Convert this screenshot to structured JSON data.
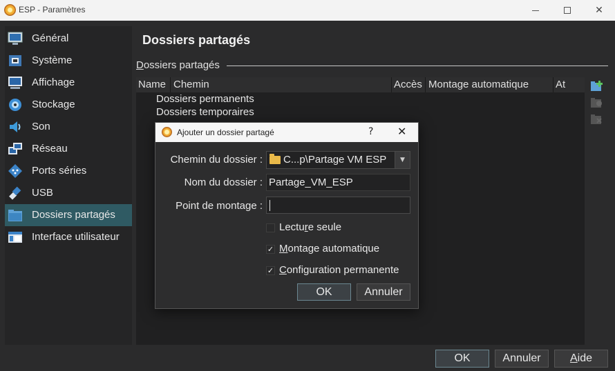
{
  "window": {
    "title": "ESP - Paramètres"
  },
  "sidebar": {
    "items": [
      {
        "label": "Général",
        "icon": "monitor-icon"
      },
      {
        "label": "Système",
        "icon": "chip-icon"
      },
      {
        "label": "Affichage",
        "icon": "display-icon"
      },
      {
        "label": "Stockage",
        "icon": "disk-icon"
      },
      {
        "label": "Son",
        "icon": "speaker-icon"
      },
      {
        "label": "Réseau",
        "icon": "network-icon"
      },
      {
        "label": "Ports séries",
        "icon": "serial-port-icon"
      },
      {
        "label": "USB",
        "icon": "usb-icon"
      },
      {
        "label": "Dossiers partagés",
        "icon": "shared-folder-icon"
      },
      {
        "label": "Interface utilisateur",
        "icon": "ui-icon"
      }
    ],
    "active_index": 8
  },
  "page": {
    "title": "Dossiers partagés",
    "group_label_underlined": "D",
    "group_label_rest": "ossiers partagés",
    "table": {
      "columns": [
        "Name",
        "Chemin",
        "Accès",
        "Montage automatique",
        "At"
      ],
      "rows": [
        "Dossiers permanents",
        "Dossiers temporaires"
      ]
    }
  },
  "buttons": {
    "ok": "OK",
    "cancel": "Annuler",
    "help_underlined": "A",
    "help_rest": "ide"
  },
  "dialog": {
    "title": "Ajouter un dossier partagé",
    "help": "?",
    "close": "✕",
    "path_label": "Chemin du dossier :",
    "path_value": "C...p\\Partage VM ESP",
    "name_label": "Nom du dossier :",
    "name_value": "Partage_VM_ESP",
    "mount_label": "Point de montage :",
    "mount_value": "",
    "readonly_a": "Lectu",
    "readonly_u": "r",
    "readonly_b": "e seule",
    "readonly_checked": false,
    "automount_u": "M",
    "automount_rest": "ontage automatique",
    "automount_checked": true,
    "permanent_u": "C",
    "permanent_rest": "onfiguration permanente",
    "permanent_checked": true,
    "ok": "OK",
    "cancel": "Annuler",
    "check_glyph": "✓"
  },
  "colors": {
    "background": "#2b2b2c",
    "sidebar_active": "#2f5a63",
    "accent_folder": "#e9b949"
  }
}
